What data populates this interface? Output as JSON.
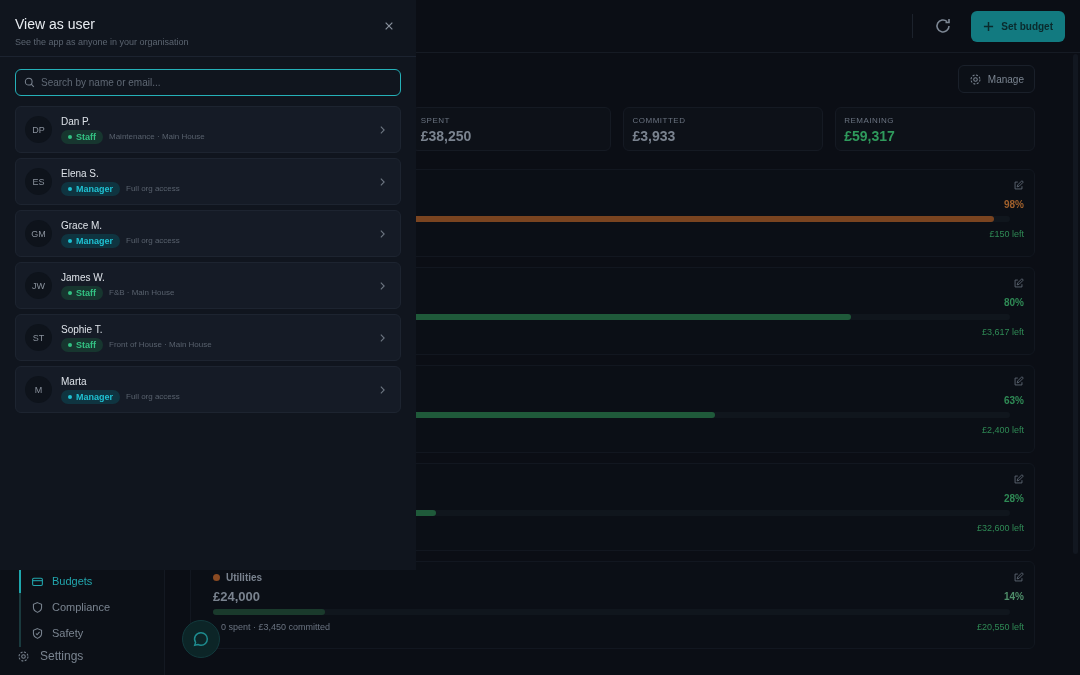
{
  "sidebar": {
    "items": [
      {
        "label": "Budgets",
        "selected": true
      },
      {
        "label": "Compliance",
        "selected": false
      },
      {
        "label": "Safety",
        "selected": false
      }
    ],
    "settings": "Settings"
  },
  "header": {
    "button": "Set budget"
  },
  "manage_button": "Manage",
  "stats": [
    {
      "label": "SPENT",
      "value": "£38,250",
      "kind": "plain"
    },
    {
      "label": "COMMITTED",
      "value": "£3,933",
      "kind": "plain"
    },
    {
      "label": "REMAINING",
      "value": "£59,317",
      "kind": "good"
    }
  ],
  "budgets": [
    {
      "percent": "98%",
      "level": 0.98,
      "kind": "warn",
      "remaining": "£150 left"
    },
    {
      "percent": "80%",
      "level": 0.8,
      "kind": "ok",
      "remaining": "£3,617 left"
    },
    {
      "percent": "63%",
      "level": 0.63,
      "kind": "ok",
      "remaining": "£2,400 left"
    },
    {
      "percent": "28%",
      "level": 0.28,
      "kind": "ok",
      "remaining": "£32,600 left"
    },
    {
      "name": "Utilities",
      "color": "#8a4a22",
      "amount": "£24,000",
      "summary": "0 spent · £3,450 committed",
      "percent": "14%",
      "level": 0.14,
      "kind": "low",
      "remaining": "£20,550 left"
    }
  ],
  "dialog": {
    "title": "View as user",
    "subtitle": "See the app as anyone in your organisation",
    "search": {
      "placeholder": "Search by name or email..."
    },
    "users": [
      {
        "initials": "DP",
        "name": "Dan P.",
        "role": "Staff",
        "kind": "staff",
        "detail": "Maintenance · Main House"
      },
      {
        "initials": "ES",
        "name": "Elena S.",
        "role": "Manager",
        "kind": "manager",
        "detail": "Full org access"
      },
      {
        "initials": "GM",
        "name": "Grace M.",
        "role": "Manager",
        "kind": "manager",
        "detail": "Full org access"
      },
      {
        "initials": "JW",
        "name": "James W.",
        "role": "Staff",
        "kind": "staff",
        "detail": "F&B · Main House"
      },
      {
        "initials": "ST",
        "name": "Sophie T.",
        "role": "Staff",
        "kind": "staff",
        "detail": "Front of House · Main House"
      },
      {
        "initials": "M",
        "name": "Marta",
        "role": "Manager",
        "kind": "manager",
        "detail": "Full org access"
      }
    ]
  }
}
